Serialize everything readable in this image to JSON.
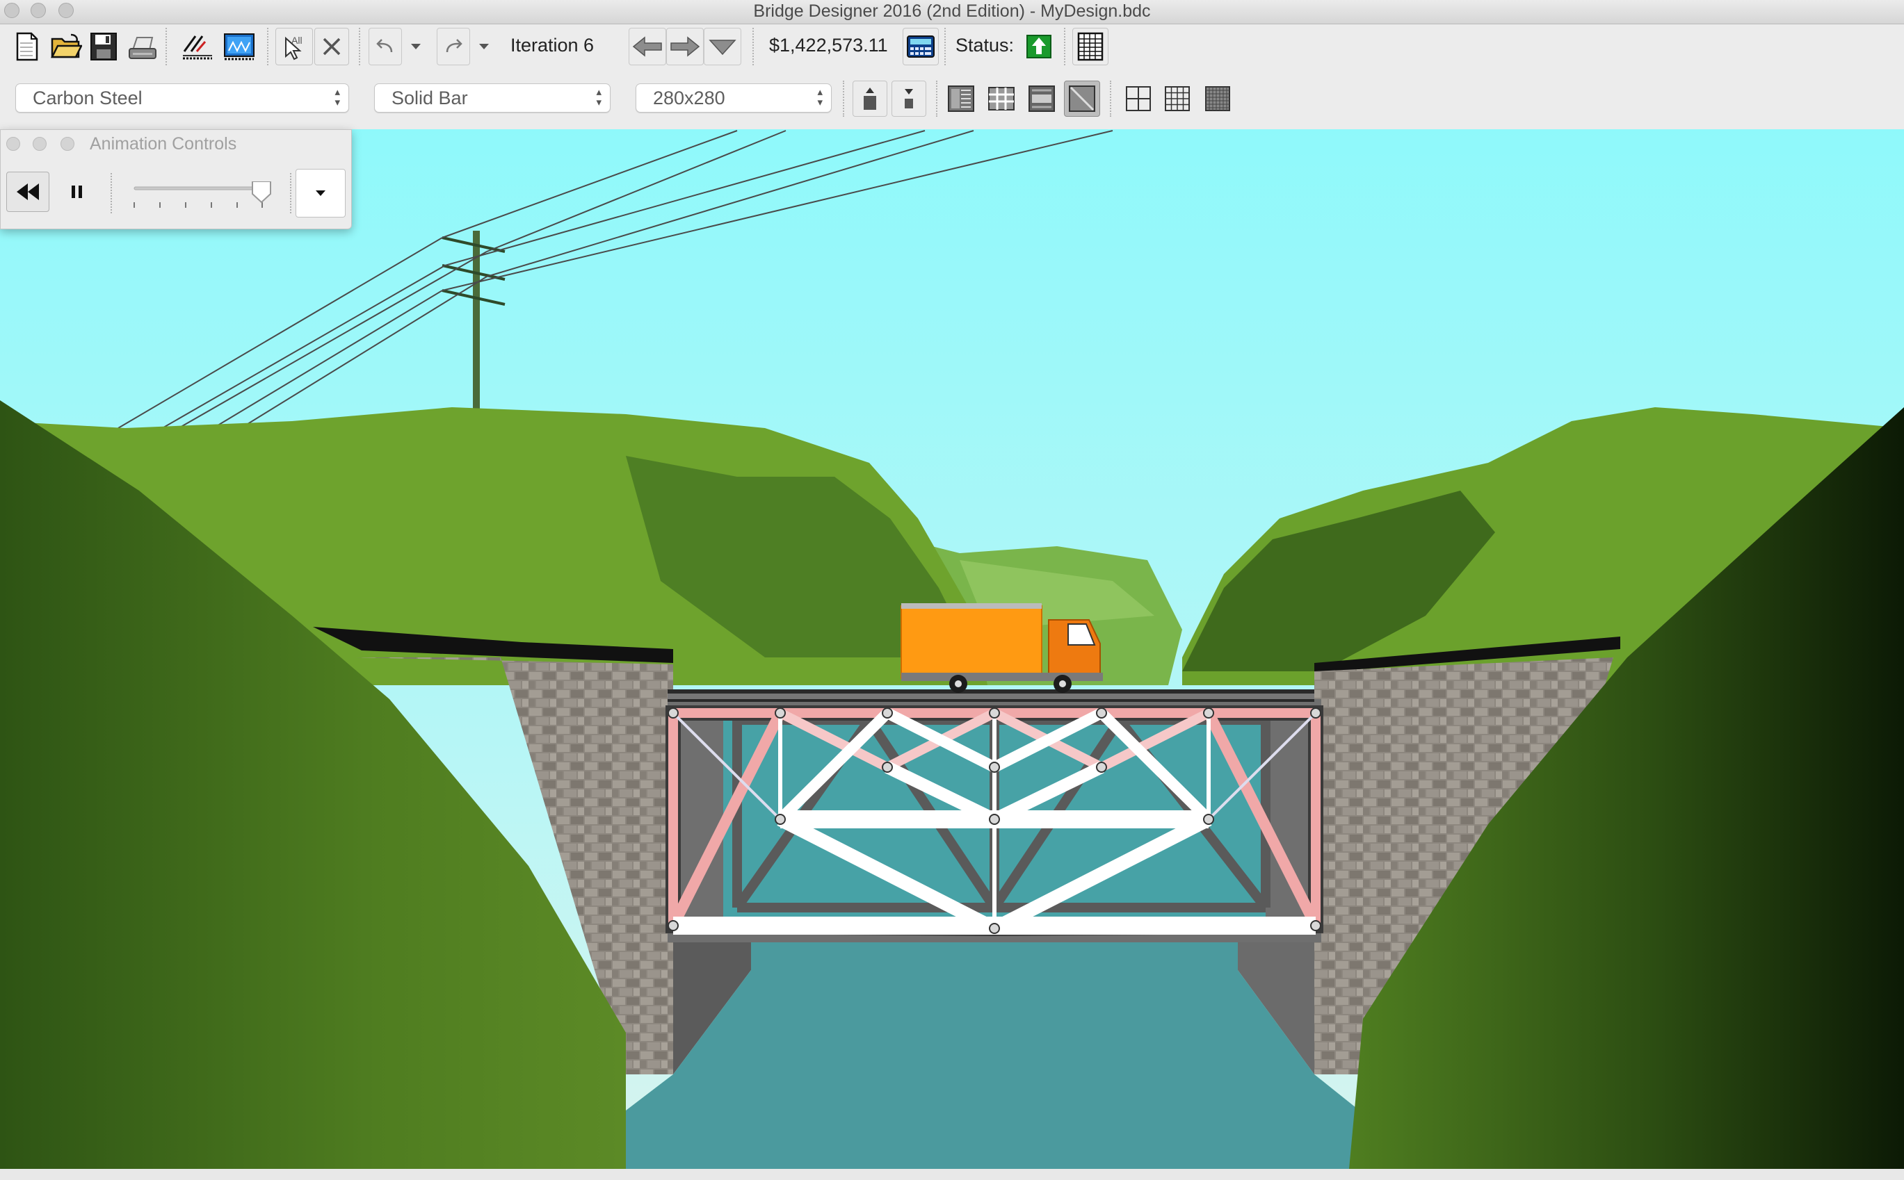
{
  "window": {
    "title": "Bridge Designer 2016 (2nd Edition) - MyDesign.bdc"
  },
  "toolbar": {
    "iteration_label": "Iteration 6",
    "cost": "$1,422,573.11",
    "status_label": "Status:",
    "status_color": "#1a9a2c",
    "buttons": [
      "new-document-icon",
      "open-folder-icon",
      "save-icon",
      "print-icon",
      "draw-members-icon",
      "drawing-board-icon",
      "select-all-icon",
      "delete-icon",
      "undo-icon",
      "undo-dropdown-icon",
      "redo-icon",
      "redo-dropdown-icon",
      "back-arrow-icon",
      "forward-arrow-icon",
      "iteration-dropdown-icon",
      "cost-calculator-icon",
      "status-test-icon",
      "report-table-icon"
    ]
  },
  "member_properties": {
    "material": "Carbon Steel",
    "cross_section": "Solid Bar",
    "size": "280x280",
    "buttons": [
      "increase-size-icon",
      "decrease-size-icon",
      "member-list-icon",
      "member-table-icon",
      "member-detail-icon",
      "member-diagonal-icon",
      "grid-coarse-icon",
      "grid-medium-icon",
      "grid-fine-icon"
    ]
  },
  "animation_controls": {
    "title": "Animation Controls",
    "slider_fraction": 0.95,
    "buttons": [
      "rewind-icon",
      "pause-icon",
      "dropdown-icon"
    ]
  },
  "scene": {
    "sky_color": "#8ff8fa",
    "water_color": "#4b9a9e",
    "truck_color": "#ff9a12",
    "compression_color": "#f0a8a8",
    "tension_color": "#ffffff"
  }
}
